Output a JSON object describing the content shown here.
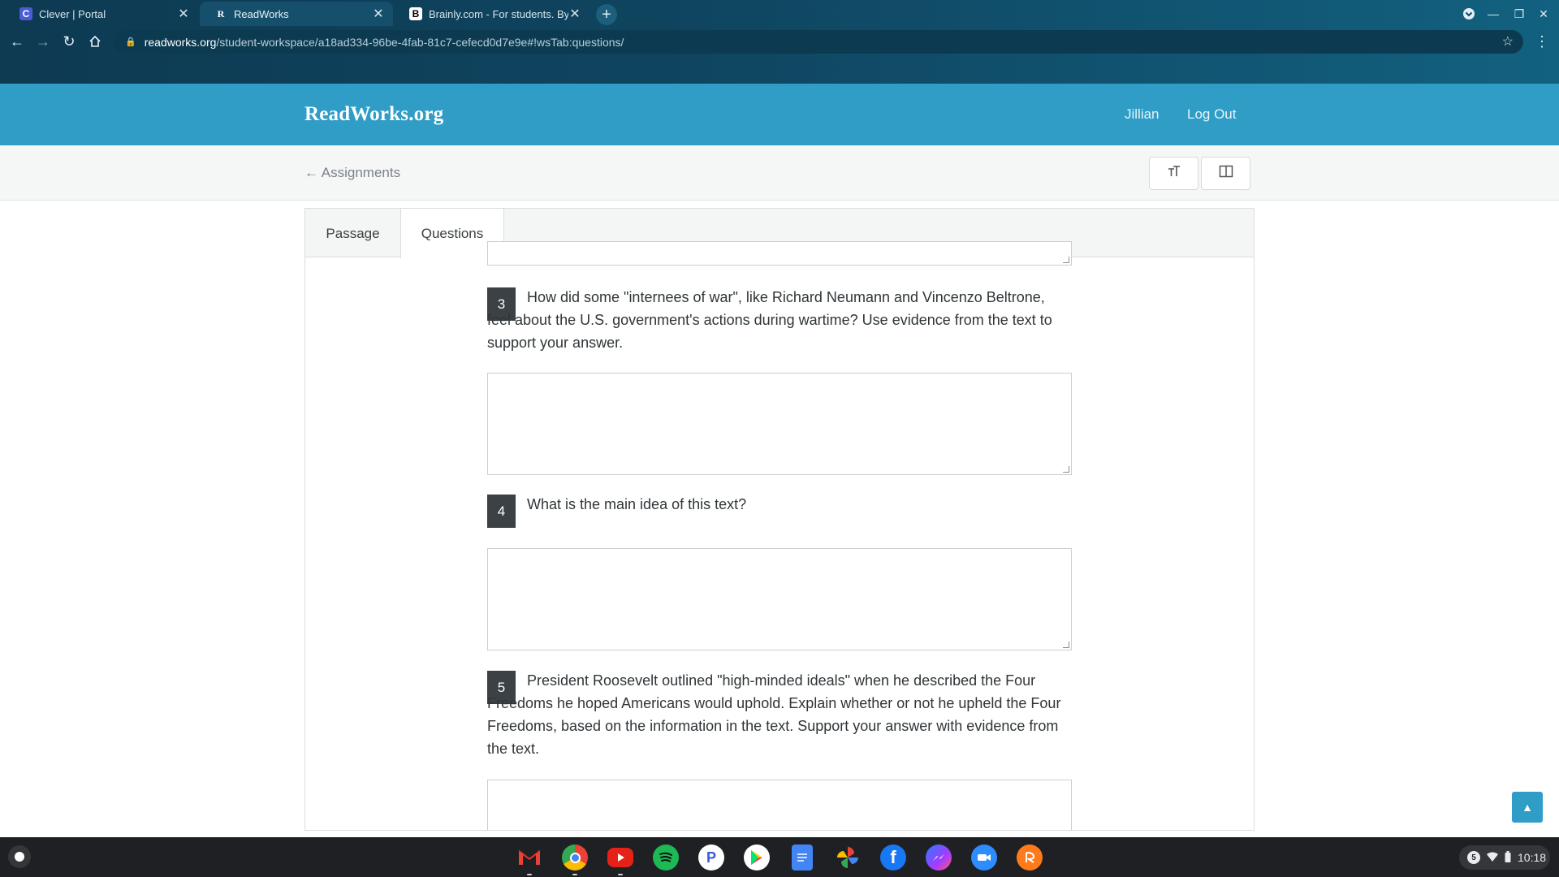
{
  "browser": {
    "tabs": [
      {
        "title": "Clever | Portal",
        "favicon": "C",
        "favicon_color": "#4a5cd6"
      },
      {
        "title": "ReadWorks",
        "favicon": "R",
        "favicon_color": "#ffffff"
      },
      {
        "title": "Brainly.com - For students. By st",
        "favicon": "B",
        "favicon_color": "#000000"
      }
    ],
    "url_host": "readworks.org",
    "url_path": "/student-workspace/a18ad334-96be-4fab-81c7-cefecd0d7e9e#!wsTab:questions/"
  },
  "header": {
    "logo": "ReadWorks.org",
    "user": "Jillian",
    "logout": "Log Out"
  },
  "subbar": {
    "back_label": "← Assignments"
  },
  "panel": {
    "tabs": [
      {
        "label": "Passage"
      },
      {
        "label": "Questions"
      }
    ],
    "active_tab": "Questions"
  },
  "questions": [
    {
      "number": "3",
      "text": "How did some \"internees of war\", like Richard Neumann and Vincenzo Beltrone, feel about the U.S. government's actions during wartime? Use evidence from the text to support your answer.",
      "answer": ""
    },
    {
      "number": "4",
      "text": "What is the main idea of this text?",
      "answer": ""
    },
    {
      "number": "5",
      "text": "President Roosevelt outlined \"high-minded ideals\" when he described the Four Freedoms he hoped Americans would uphold. Explain whether or not he upheld the Four Freedoms, based on the information in the text. Support your answer with evidence from the text.",
      "answer": ""
    }
  ],
  "shelf": {
    "apps": [
      "gmail-icon",
      "chrome-icon",
      "youtube-icon",
      "spotify-icon",
      "pandora-icon",
      "play-store-icon",
      "docs-icon",
      "photos-icon",
      "facebook-icon",
      "messenger-icon",
      "zoom-icon",
      "reading-app-icon"
    ],
    "notification_count": "5",
    "time": "10:18"
  },
  "colors": {
    "brand": "#2f9dc6",
    "question_badge": "#3b4144"
  }
}
